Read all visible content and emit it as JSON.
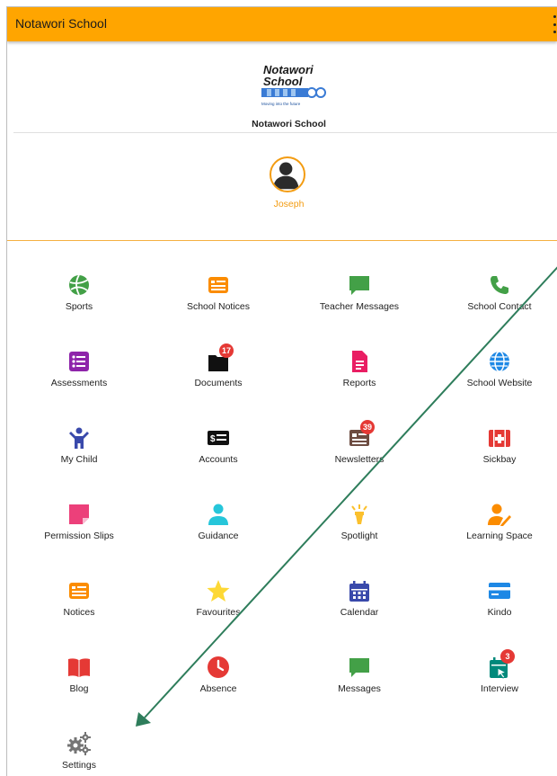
{
  "app": {
    "title": "Notawori School"
  },
  "colors": {
    "accent": "#ffa500",
    "avatar_ring": "#f39c12",
    "annotation_arrow": "#2e7d5b"
  },
  "header": {
    "logo": {
      "line1": "Notawori",
      "line2": "School",
      "tagline": "Moving into the future"
    },
    "school_name": "Notawori School"
  },
  "profile": {
    "name": "Joseph"
  },
  "menu": [
    {
      "label": "Sports",
      "icon": "volleyball-icon"
    },
    {
      "label": "School Notices",
      "icon": "notices-icon"
    },
    {
      "label": "Teacher Messages",
      "icon": "chat-bubble-icon"
    },
    {
      "label": "School Contact",
      "icon": "phone-icon"
    },
    {
      "label": "Assessments",
      "icon": "list-icon"
    },
    {
      "label": "Documents",
      "icon": "folder-icon",
      "badge": "17"
    },
    {
      "label": "Reports",
      "icon": "document-icon"
    },
    {
      "label": "School Website",
      "icon": "globe-icon"
    },
    {
      "label": "My Child",
      "icon": "child-icon"
    },
    {
      "label": "Accounts",
      "icon": "bill-icon"
    },
    {
      "label": "Newsletters",
      "icon": "newspaper-icon",
      "badge": "39"
    },
    {
      "label": "Sickbay",
      "icon": "first-aid-icon"
    },
    {
      "label": "Permission Slips",
      "icon": "sticky-note-icon"
    },
    {
      "label": "Guidance",
      "icon": "person-icon"
    },
    {
      "label": "Spotlight",
      "icon": "spotlight-icon"
    },
    {
      "label": "Learning Space",
      "icon": "person-edit-icon"
    },
    {
      "label": "Notices",
      "icon": "notices-icon"
    },
    {
      "label": "Favourites",
      "icon": "star-icon"
    },
    {
      "label": "Calendar",
      "icon": "calendar-icon"
    },
    {
      "label": "Kindo",
      "icon": "credit-card-icon"
    },
    {
      "label": "Blog",
      "icon": "book-icon"
    },
    {
      "label": "Absence",
      "icon": "clock-icon"
    },
    {
      "label": "Messages",
      "icon": "chat-bubble-icon"
    },
    {
      "label": "Interview",
      "icon": "calendar-click-icon",
      "badge": "3"
    },
    {
      "label": "Settings",
      "icon": "gears-icon"
    }
  ]
}
